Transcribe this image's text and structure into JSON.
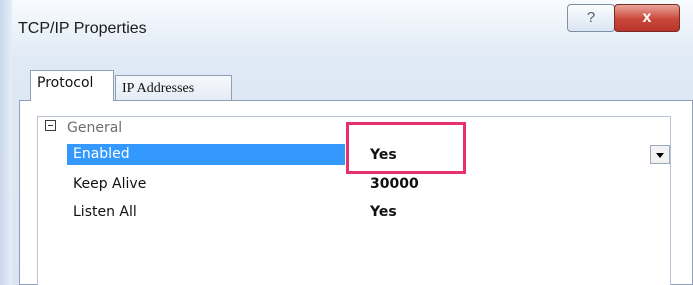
{
  "window": {
    "title": "TCP/IP Properties",
    "help_button": "?",
    "close_button": "x"
  },
  "tabs": [
    {
      "label": "Protocol",
      "active": true
    },
    {
      "label": "IP Addresses",
      "active": false
    }
  ],
  "grid": {
    "category": "General",
    "rows": [
      {
        "name": "Enabled",
        "value": "Yes",
        "selected": true
      },
      {
        "name": "Keep Alive",
        "value": "30000",
        "selected": false
      },
      {
        "name": "Listen All",
        "value": "Yes",
        "selected": false
      }
    ]
  },
  "colors": {
    "selection": "#3399ff",
    "highlight": "#e8316a"
  },
  "icons": {
    "collapse": "minus-box-icon",
    "dropdown": "chevron-down-icon"
  }
}
